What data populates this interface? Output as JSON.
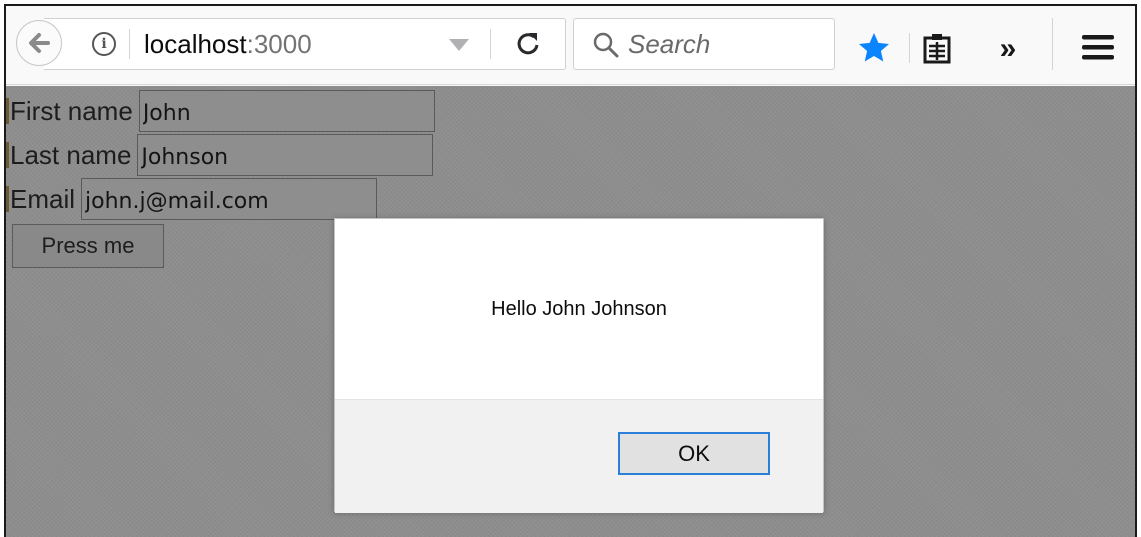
{
  "browser": {
    "url_host": "localhost",
    "url_port": ":3000",
    "search_placeholder": "Search",
    "overflow_glyph": "»"
  },
  "colors": {
    "bookmark_star": "#0a84ff",
    "dialog_ok_border": "#2b7fd9",
    "dimmed_background": "#8e8e8e"
  },
  "form": {
    "first_name_label": "First name",
    "first_name_value": "John",
    "last_name_label": "Last name",
    "last_name_value": "Johnson",
    "email_label": "Email",
    "email_value": "john.j@mail.com",
    "submit_label": "Press me"
  },
  "dialog": {
    "message": "Hello John Johnson",
    "ok_label": "OK"
  },
  "icons": [
    "back-arrow-icon",
    "info-icon",
    "dropdown-icon",
    "reload-icon",
    "search-icon",
    "bookmark-star-icon",
    "reader-view-icon",
    "overflow-chevron-icon",
    "hamburger-menu-icon"
  ]
}
